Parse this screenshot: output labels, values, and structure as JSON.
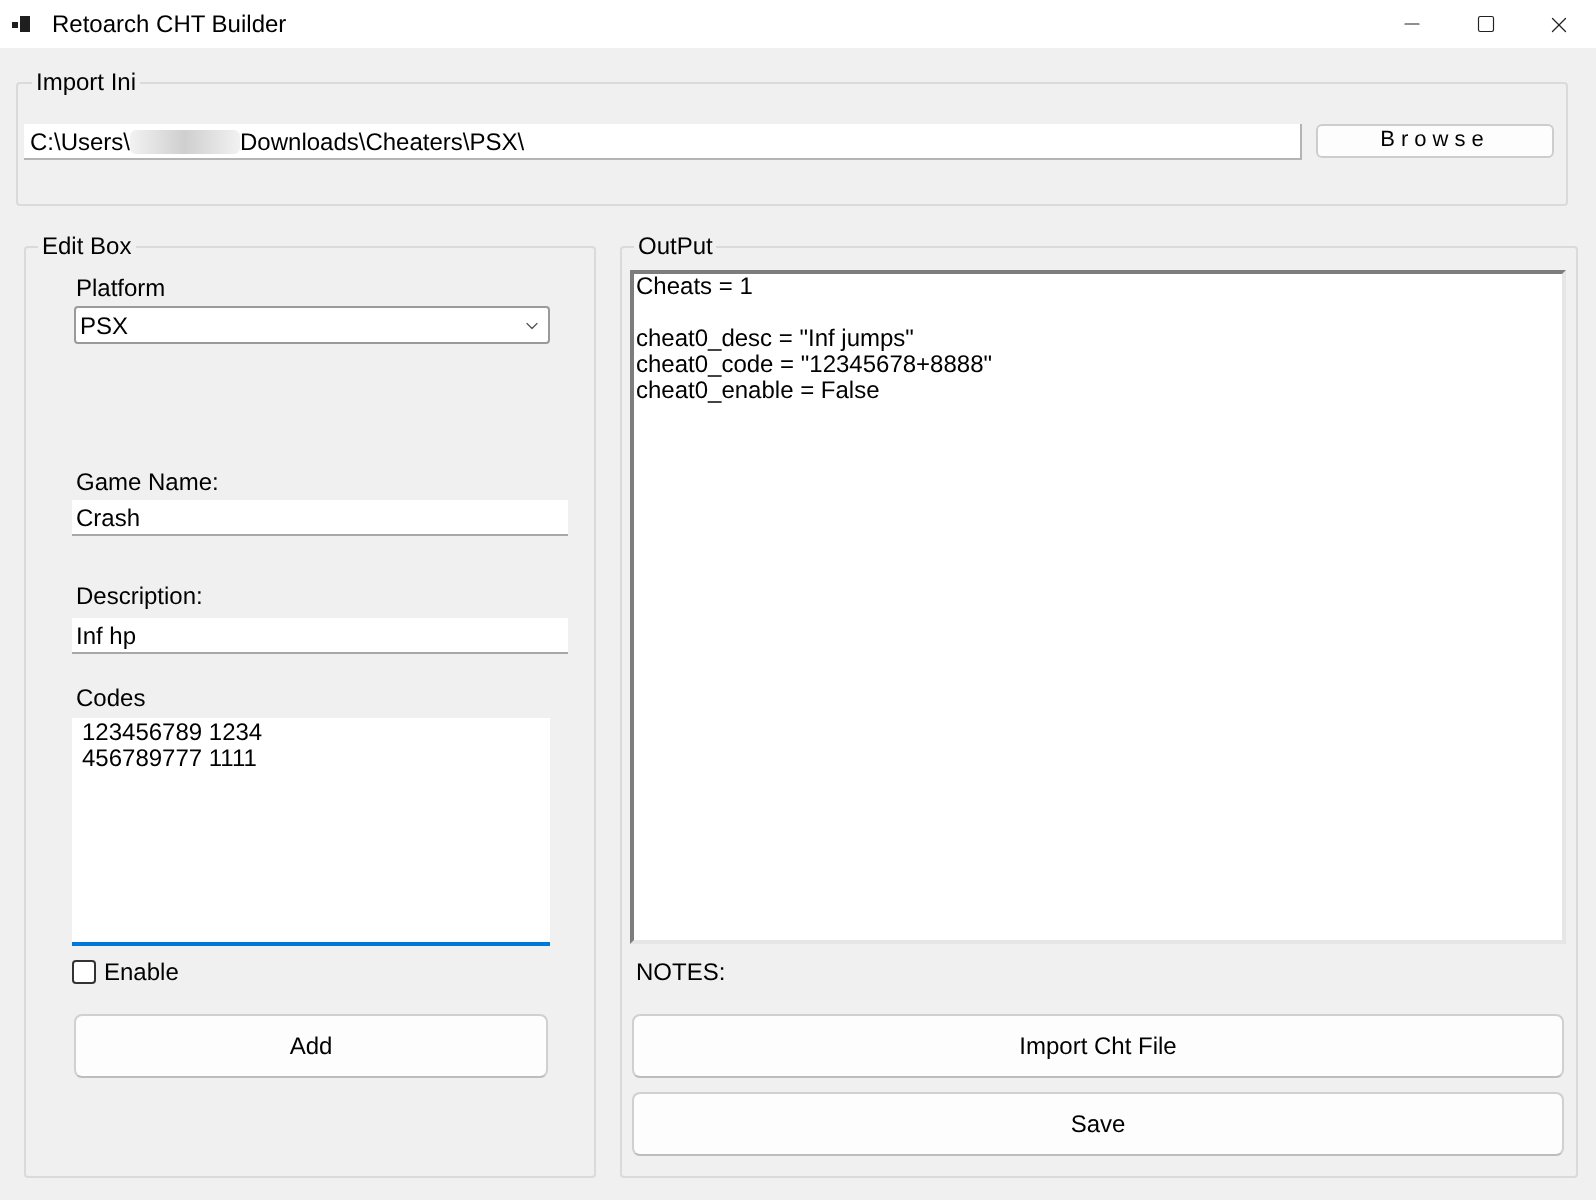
{
  "window": {
    "title": "Retoarch CHT Builder"
  },
  "import_group": {
    "title": "Import Ini",
    "path_field": {
      "value_before": "C:\\Users\\",
      "redacted": true,
      "value_after": "Downloads\\Cheaters\\PSX\\"
    },
    "browse_button": "Browse"
  },
  "edit_group": {
    "title": "Edit Box",
    "fields": [
      {
        "kind": "select",
        "label": "Platform",
        "value": "PSX",
        "focused": false
      },
      {
        "kind": "input",
        "label": "Game Name:",
        "value": "Crash",
        "focused": false
      },
      {
        "kind": "input",
        "label": "Description:",
        "value": "Inf hp",
        "focused": false
      },
      {
        "kind": "textarea",
        "label": "Codes",
        "value": "123456789 1234\n456789777 1111",
        "focused": true
      }
    ],
    "enable_checkbox": {
      "label": "Enable",
      "checked": false
    },
    "add_button": "Add"
  },
  "output_group": {
    "title": "OutPut",
    "output_text": "Cheats = 1\n\ncheat0_desc = \"Inf jumps\"\ncheat0_code = \"12345678+8888\"\ncheat0_enable = False",
    "notes_label": "NOTES:",
    "buttons": [
      "Import Cht File",
      "Save"
    ]
  }
}
